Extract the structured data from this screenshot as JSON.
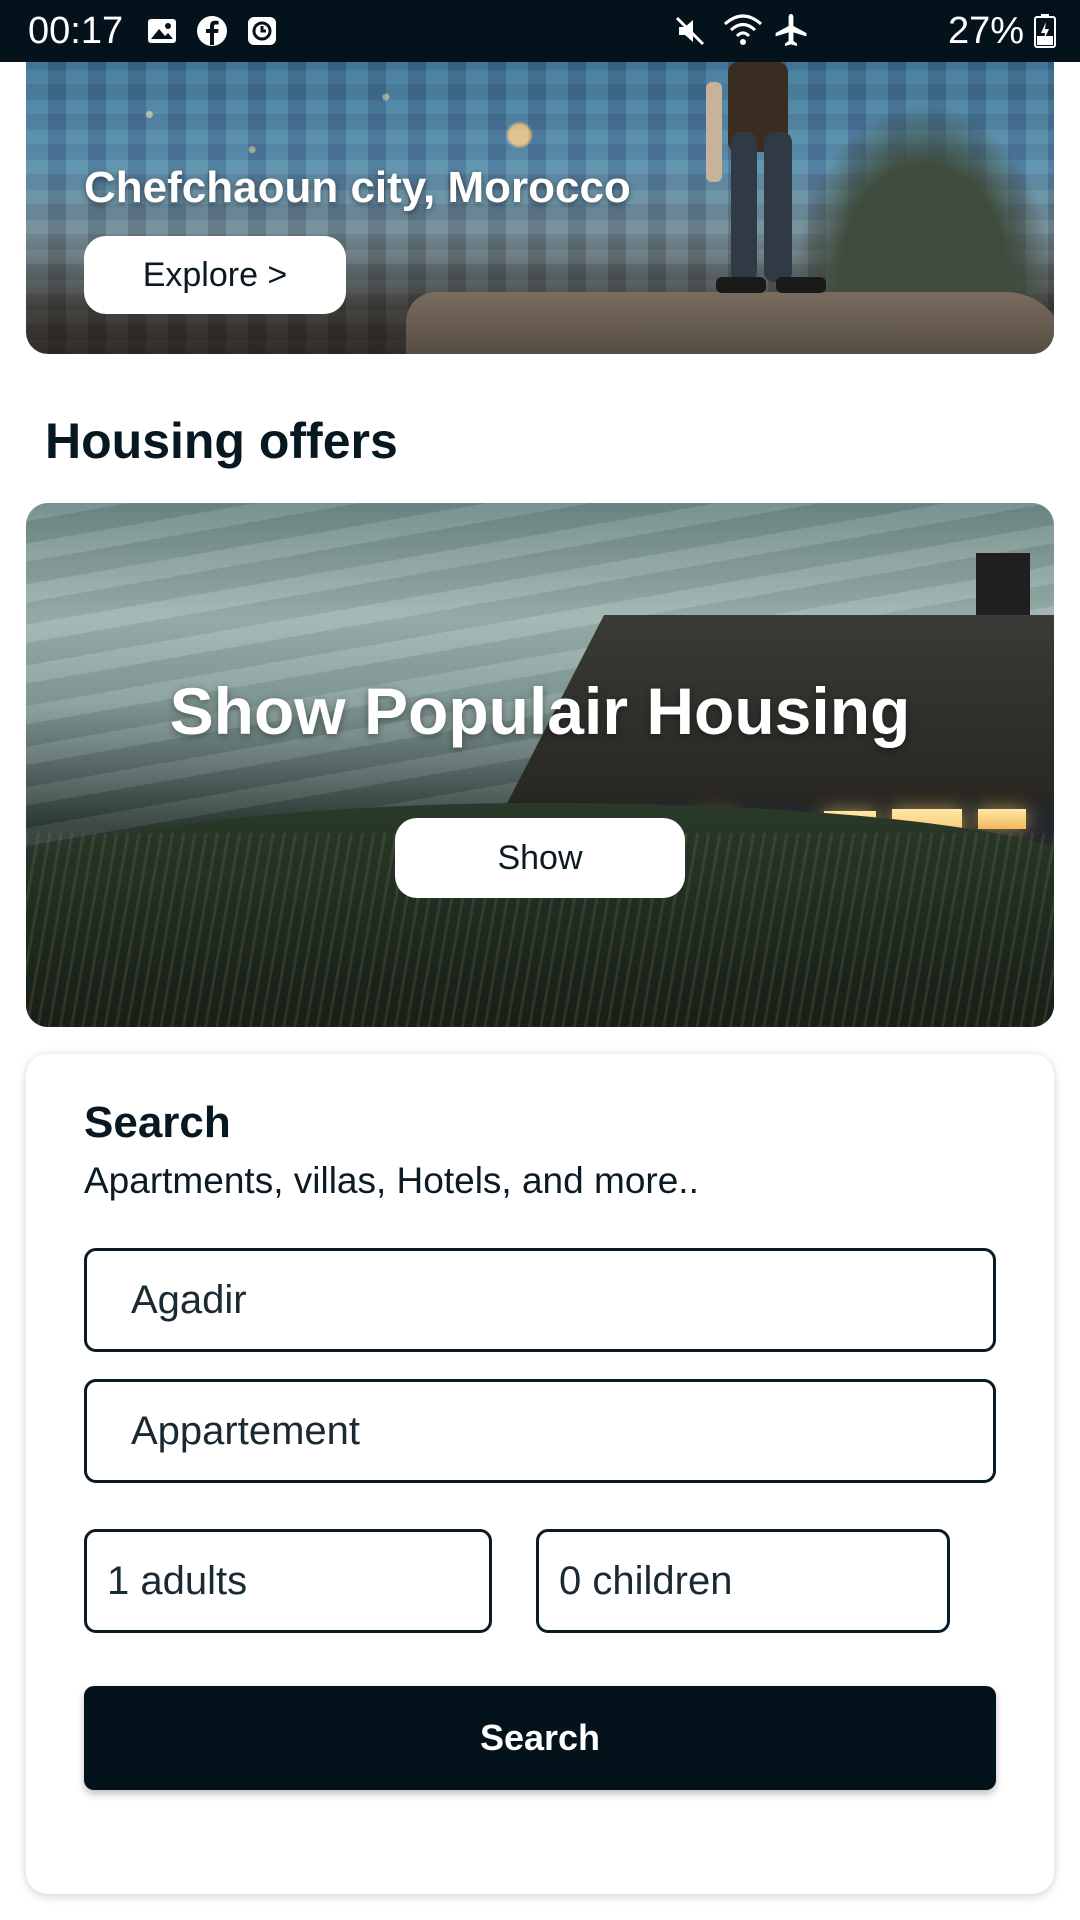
{
  "status_bar": {
    "time": "00:17",
    "left_icons": [
      "gallery-icon",
      "facebook-icon",
      "clock-app-icon"
    ],
    "right_icons": [
      "mute-icon",
      "wifi-icon",
      "airplane-icon",
      "battery-icon"
    ],
    "battery": "27%"
  },
  "hero": {
    "title": "Chefchaoun city, Morocco",
    "explore_label": "Explore >"
  },
  "housing": {
    "section_title": "Housing offers",
    "card_title": "Show Populair Housing",
    "show_label": "Show"
  },
  "search": {
    "title": "Search",
    "subtitle": "Apartments, villas, Hotels, and more..",
    "city_value": "Agadir",
    "type_value": "Appartement",
    "adults_value": "1 adults",
    "children_value": "0 children",
    "button_label": "Search"
  },
  "colors": {
    "primary_dark": "#04121b",
    "text_dark": "#071821",
    "card_bg": "#ffffff"
  }
}
